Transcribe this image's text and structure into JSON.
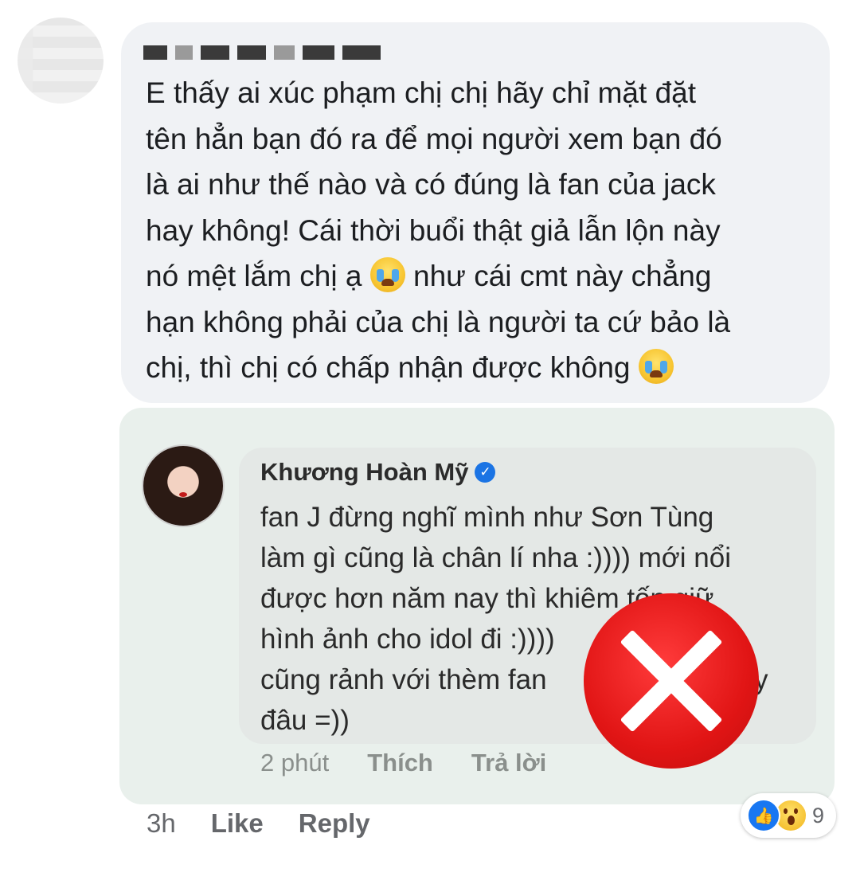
{
  "comment": {
    "author_name_redacted": true,
    "lines": [
      "E thấy ai xúc phạm chị chị hãy chỉ mặt đặt",
      "tên hẳn bạn đó ra để mọi người xem bạn đó",
      "là ai như thế nào và có đúng là fan của jack",
      "hay không! Cái thời buổi thật giả lẫn lộn này"
    ],
    "line5_before_emoji": "nó mệt lắm chị ạ",
    "line5_after_emoji": "như cái cmt này chẳng",
    "line6": "hạn không phải của chị là người ta cứ bảo là",
    "line7_before_emoji": "chị, thì chị có chấp nhận được không",
    "emoji": "loudly-crying-face-icon",
    "time": "3h",
    "like_label": "Like",
    "reply_label": "Reply",
    "reaction_count": "9",
    "reaction_icons": [
      "like-icon",
      "wow-icon"
    ]
  },
  "reply": {
    "author": "Khương Hoàn Mỹ",
    "verified": true,
    "lines": [
      "fan J đừng nghĩ mình như Sơn Tùng",
      "làm gì cũng là chân lí nha :)))) mới nổi",
      "được hơn năm nay thì khiêm tốn giữ",
      "hình ảnh cho idol đi :))))",
      "cũng rảnh với thèm fan",
      "đâu =))"
    ],
    "line5_tail": "y",
    "time": "2 phút",
    "like_label": "Thích",
    "reply_label": "Trả lời",
    "overlay": "red-x-mark-icon",
    "colors": {
      "overlay": "#e11515",
      "verified": "#1b74e4"
    }
  }
}
